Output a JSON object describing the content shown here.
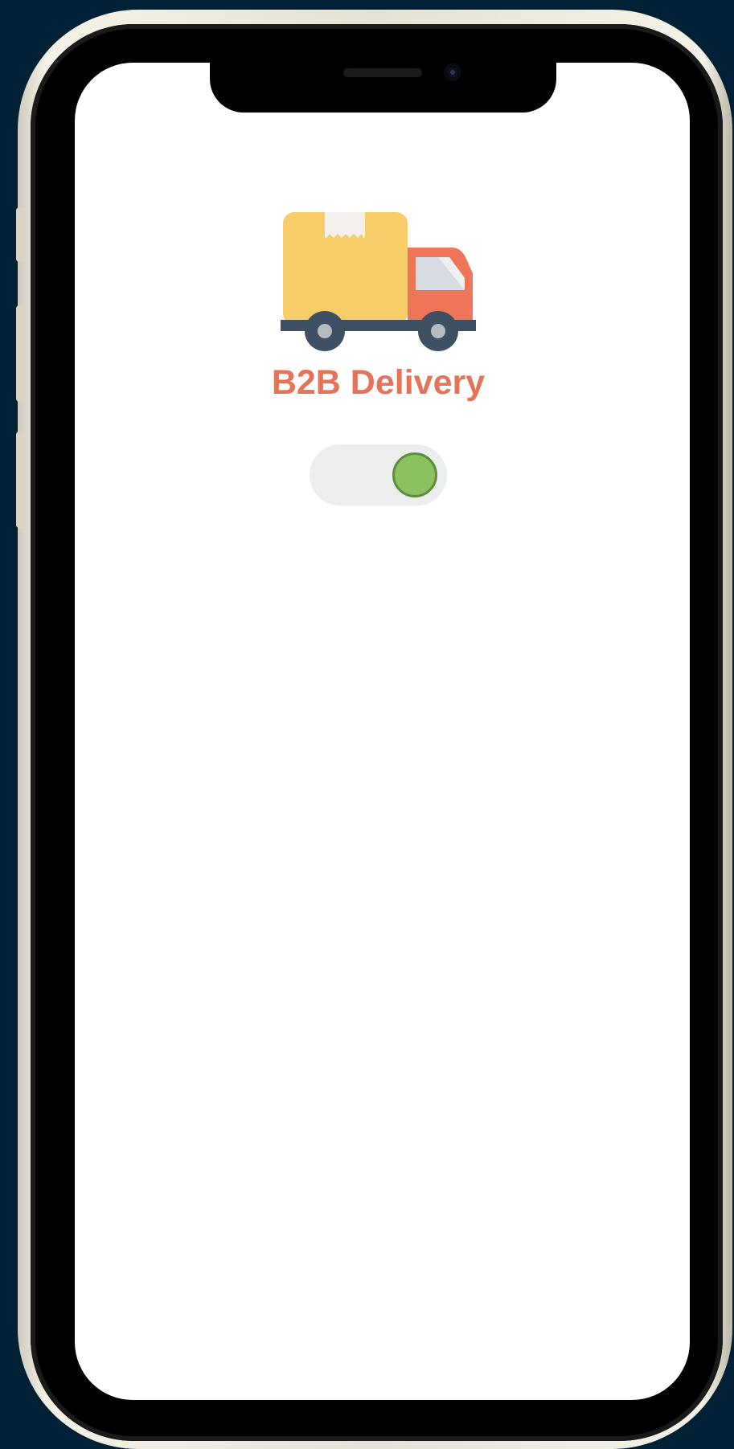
{
  "app": {
    "title": "B2B Delivery",
    "logo_icon": "delivery-truck-icon"
  },
  "toggle": {
    "state": "on",
    "knob_color": "#8cc160",
    "track_color": "#eceeee"
  },
  "colors": {
    "background": "#002135",
    "title": "#e57357",
    "truck_box": "#f7cd69",
    "truck_cab": "#ee7558",
    "truck_chassis": "#3f4f64"
  }
}
